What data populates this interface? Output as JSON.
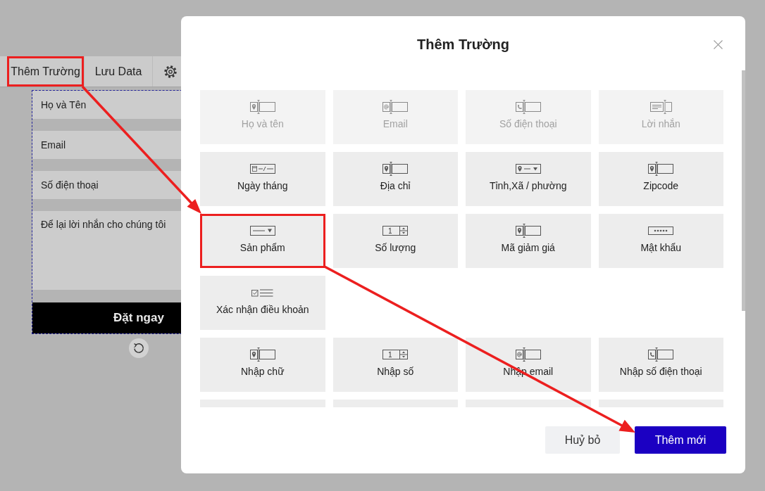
{
  "editor": {
    "toolbar": [
      {
        "kind": "text",
        "label": "Thêm Trường",
        "highlighted": true
      },
      {
        "kind": "text",
        "label": "Lưu Data",
        "highlighted": false
      },
      {
        "kind": "gear",
        "highlighted": false
      }
    ],
    "form": {
      "fields": [
        {
          "kind": "input",
          "placeholder": "Họ và Tên"
        },
        {
          "kind": "input",
          "placeholder": "Email"
        },
        {
          "kind": "input",
          "placeholder": "Số điện thoại"
        },
        {
          "kind": "textarea",
          "placeholder": "Để lại lời nhắn cho chúng tôi"
        }
      ],
      "submit": "Đặt ngay"
    }
  },
  "dialog": {
    "title": "Thêm Trường",
    "groups": [
      {
        "cards": [
          {
            "kind": "pin",
            "label": "Họ và tên",
            "disabled": true,
            "highlighted": false
          },
          {
            "kind": "email",
            "label": "Email",
            "disabled": true,
            "highlighted": false
          },
          {
            "kind": "phone",
            "label": "Số điện thoại",
            "disabled": true,
            "highlighted": false
          },
          {
            "kind": "message",
            "label": "Lời nhắn",
            "disabled": true,
            "highlighted": false
          },
          {
            "kind": "date",
            "label": "Ngày tháng",
            "disabled": false,
            "highlighted": false
          },
          {
            "kind": "pin",
            "label": "Địa chỉ",
            "disabled": false,
            "highlighted": false
          },
          {
            "kind": "location",
            "label": "Tỉnh,Xã / phường",
            "disabled": false,
            "highlighted": false
          },
          {
            "kind": "pin",
            "label": "Zipcode",
            "disabled": false,
            "highlighted": false
          },
          {
            "kind": "select",
            "label": "Sản phẩm",
            "disabled": false,
            "highlighted": true
          },
          {
            "kind": "number",
            "label": "Số lượng",
            "disabled": false,
            "highlighted": false
          },
          {
            "kind": "pin",
            "label": "Mã giảm giá",
            "disabled": false,
            "highlighted": false
          },
          {
            "kind": "password",
            "label": "Mật khẩu",
            "disabled": false,
            "highlighted": false
          },
          {
            "kind": "checkbox",
            "label": "Xác nhận điều khoản",
            "disabled": false,
            "highlighted": false
          }
        ]
      },
      {
        "cards": [
          {
            "kind": "pin",
            "label": "Nhập chữ",
            "disabled": false,
            "highlighted": false
          },
          {
            "kind": "number",
            "label": "Nhập số",
            "disabled": false,
            "highlighted": false
          },
          {
            "kind": "email",
            "label": "Nhập email",
            "disabled": false,
            "highlighted": false
          },
          {
            "kind": "phone",
            "label": "Nhập số điện thoại",
            "disabled": false,
            "highlighted": false
          },
          {
            "kind": "cut"
          },
          {
            "kind": "cut"
          },
          {
            "kind": "cut"
          },
          {
            "kind": "cut"
          }
        ]
      }
    ],
    "buttons": [
      {
        "kind": "secondary",
        "label": "Huỷ bỏ"
      },
      {
        "kind": "primary",
        "label": "Thêm mới"
      }
    ]
  }
}
